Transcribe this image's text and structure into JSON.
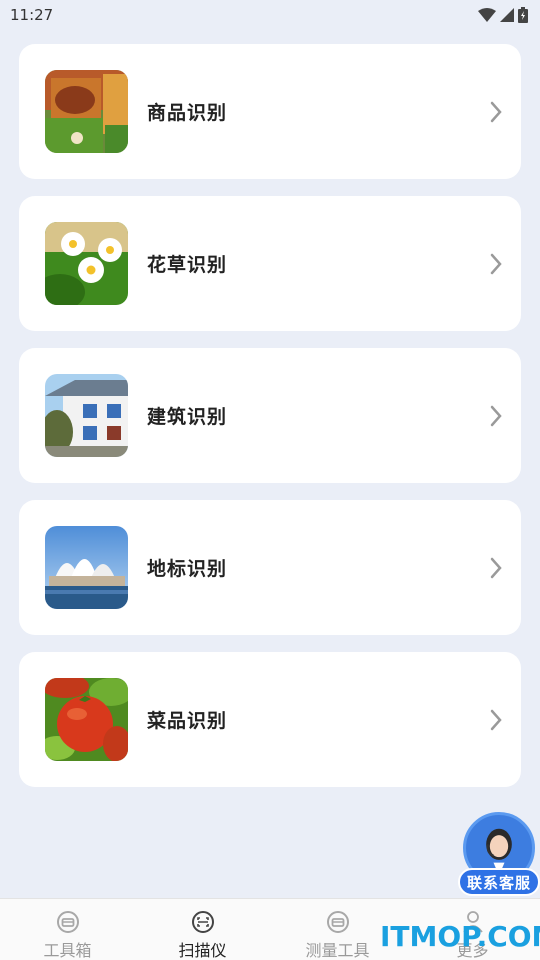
{
  "status_bar": {
    "time": "11:27"
  },
  "cards": [
    {
      "label": "商品识别",
      "icon": "product-photo"
    },
    {
      "label": "花草识别",
      "icon": "flower-photo"
    },
    {
      "label": "建筑识别",
      "icon": "building-photo"
    },
    {
      "label": "地标识别",
      "icon": "landmark-photo"
    },
    {
      "label": "菜品识别",
      "icon": "dish-photo"
    }
  ],
  "customer_service": {
    "label": "联系客服"
  },
  "tabs": [
    {
      "label": "工具箱",
      "icon": "toolbox-icon",
      "active": false
    },
    {
      "label": "扫描仪",
      "icon": "scan-icon",
      "active": true
    },
    {
      "label": "测量工具",
      "icon": "measure-icon",
      "active": false
    },
    {
      "label": "更多",
      "icon": "person-icon",
      "active": false
    }
  ],
  "watermark": "ITMOP.COM",
  "colors": {
    "background": "#eaeef7",
    "accent": "#2f72e6",
    "watermark": "#1aa0e0"
  }
}
